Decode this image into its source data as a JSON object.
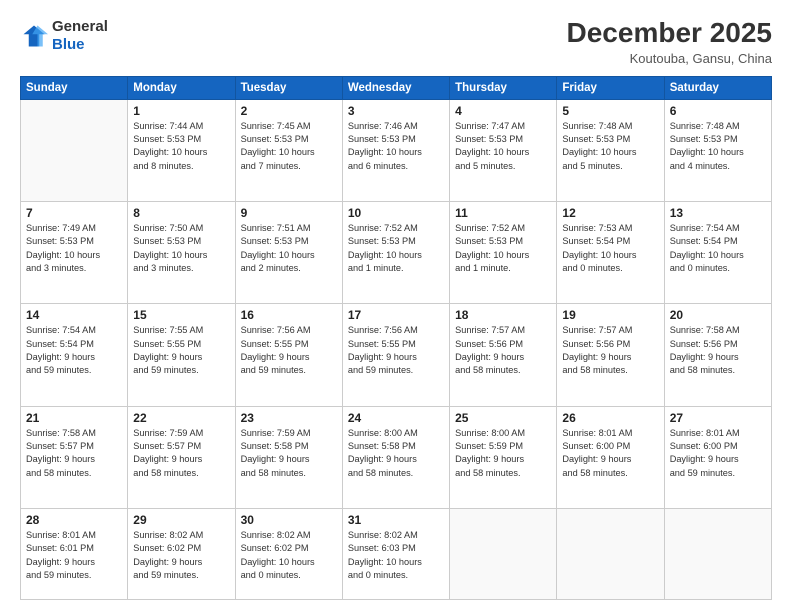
{
  "logo": {
    "line1": "General",
    "line2": "Blue"
  },
  "title": "December 2025",
  "location": "Koutouba, Gansu, China",
  "days_header": [
    "Sunday",
    "Monday",
    "Tuesday",
    "Wednesday",
    "Thursday",
    "Friday",
    "Saturday"
  ],
  "weeks": [
    [
      {
        "day": "",
        "info": ""
      },
      {
        "day": "1",
        "info": "Sunrise: 7:44 AM\nSunset: 5:53 PM\nDaylight: 10 hours\nand 8 minutes."
      },
      {
        "day": "2",
        "info": "Sunrise: 7:45 AM\nSunset: 5:53 PM\nDaylight: 10 hours\nand 7 minutes."
      },
      {
        "day": "3",
        "info": "Sunrise: 7:46 AM\nSunset: 5:53 PM\nDaylight: 10 hours\nand 6 minutes."
      },
      {
        "day": "4",
        "info": "Sunrise: 7:47 AM\nSunset: 5:53 PM\nDaylight: 10 hours\nand 5 minutes."
      },
      {
        "day": "5",
        "info": "Sunrise: 7:48 AM\nSunset: 5:53 PM\nDaylight: 10 hours\nand 5 minutes."
      },
      {
        "day": "6",
        "info": "Sunrise: 7:48 AM\nSunset: 5:53 PM\nDaylight: 10 hours\nand 4 minutes."
      }
    ],
    [
      {
        "day": "7",
        "info": "Sunrise: 7:49 AM\nSunset: 5:53 PM\nDaylight: 10 hours\nand 3 minutes."
      },
      {
        "day": "8",
        "info": "Sunrise: 7:50 AM\nSunset: 5:53 PM\nDaylight: 10 hours\nand 3 minutes."
      },
      {
        "day": "9",
        "info": "Sunrise: 7:51 AM\nSunset: 5:53 PM\nDaylight: 10 hours\nand 2 minutes."
      },
      {
        "day": "10",
        "info": "Sunrise: 7:52 AM\nSunset: 5:53 PM\nDaylight: 10 hours\nand 1 minute."
      },
      {
        "day": "11",
        "info": "Sunrise: 7:52 AM\nSunset: 5:53 PM\nDaylight: 10 hours\nand 1 minute."
      },
      {
        "day": "12",
        "info": "Sunrise: 7:53 AM\nSunset: 5:54 PM\nDaylight: 10 hours\nand 0 minutes."
      },
      {
        "day": "13",
        "info": "Sunrise: 7:54 AM\nSunset: 5:54 PM\nDaylight: 10 hours\nand 0 minutes."
      }
    ],
    [
      {
        "day": "14",
        "info": "Sunrise: 7:54 AM\nSunset: 5:54 PM\nDaylight: 9 hours\nand 59 minutes."
      },
      {
        "day": "15",
        "info": "Sunrise: 7:55 AM\nSunset: 5:55 PM\nDaylight: 9 hours\nand 59 minutes."
      },
      {
        "day": "16",
        "info": "Sunrise: 7:56 AM\nSunset: 5:55 PM\nDaylight: 9 hours\nand 59 minutes."
      },
      {
        "day": "17",
        "info": "Sunrise: 7:56 AM\nSunset: 5:55 PM\nDaylight: 9 hours\nand 59 minutes."
      },
      {
        "day": "18",
        "info": "Sunrise: 7:57 AM\nSunset: 5:56 PM\nDaylight: 9 hours\nand 58 minutes."
      },
      {
        "day": "19",
        "info": "Sunrise: 7:57 AM\nSunset: 5:56 PM\nDaylight: 9 hours\nand 58 minutes."
      },
      {
        "day": "20",
        "info": "Sunrise: 7:58 AM\nSunset: 5:56 PM\nDaylight: 9 hours\nand 58 minutes."
      }
    ],
    [
      {
        "day": "21",
        "info": "Sunrise: 7:58 AM\nSunset: 5:57 PM\nDaylight: 9 hours\nand 58 minutes."
      },
      {
        "day": "22",
        "info": "Sunrise: 7:59 AM\nSunset: 5:57 PM\nDaylight: 9 hours\nand 58 minutes."
      },
      {
        "day": "23",
        "info": "Sunrise: 7:59 AM\nSunset: 5:58 PM\nDaylight: 9 hours\nand 58 minutes."
      },
      {
        "day": "24",
        "info": "Sunrise: 8:00 AM\nSunset: 5:58 PM\nDaylight: 9 hours\nand 58 minutes."
      },
      {
        "day": "25",
        "info": "Sunrise: 8:00 AM\nSunset: 5:59 PM\nDaylight: 9 hours\nand 58 minutes."
      },
      {
        "day": "26",
        "info": "Sunrise: 8:01 AM\nSunset: 6:00 PM\nDaylight: 9 hours\nand 58 minutes."
      },
      {
        "day": "27",
        "info": "Sunrise: 8:01 AM\nSunset: 6:00 PM\nDaylight: 9 hours\nand 59 minutes."
      }
    ],
    [
      {
        "day": "28",
        "info": "Sunrise: 8:01 AM\nSunset: 6:01 PM\nDaylight: 9 hours\nand 59 minutes."
      },
      {
        "day": "29",
        "info": "Sunrise: 8:02 AM\nSunset: 6:02 PM\nDaylight: 9 hours\nand 59 minutes."
      },
      {
        "day": "30",
        "info": "Sunrise: 8:02 AM\nSunset: 6:02 PM\nDaylight: 10 hours\nand 0 minutes."
      },
      {
        "day": "31",
        "info": "Sunrise: 8:02 AM\nSunset: 6:03 PM\nDaylight: 10 hours\nand 0 minutes."
      },
      {
        "day": "",
        "info": ""
      },
      {
        "day": "",
        "info": ""
      },
      {
        "day": "",
        "info": ""
      }
    ]
  ]
}
